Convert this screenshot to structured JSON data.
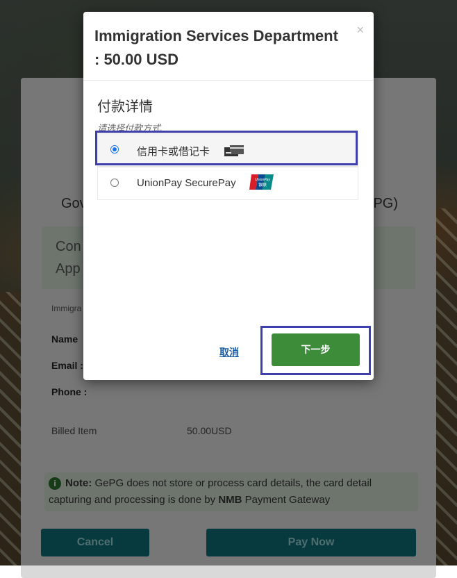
{
  "background": {
    "heading_left": "Gov",
    "heading_right": "PG)",
    "confirm_line1": "Con",
    "confirm_line2": "App",
    "immigration_label": "Immigra",
    "name_label": "Name",
    "email_label": "Email :",
    "phone_label": "Phone :",
    "billed_item_label": "Billed Item",
    "billed_item_value": "50.00USD",
    "note_prefix": "Note:",
    "note_text_1": " GePG does not store or process card details, the card detail capturing and processing is done by ",
    "note_bold": "NMB",
    "note_text_2": " Payment Gateway",
    "cancel_button": "Cancel",
    "pay_button": "Pay Now"
  },
  "modal": {
    "title": "Immigration Services Department : 50.00 USD",
    "close": "×",
    "section_title": "付款详情",
    "section_subtitle": "请选择付款方式.",
    "options": [
      {
        "label": "信用卡或借记卡",
        "selected": true,
        "icon": "credit-card-icon"
      },
      {
        "label": "UnionPay SecurePay",
        "selected": false,
        "icon": "unionpay-logo"
      }
    ],
    "cancel_link": "取消",
    "next_button": "下一步"
  },
  "colors": {
    "next_button": "#3d8c3a",
    "highlight_border": "#3f3fae",
    "primary_button": "#0e6b73"
  }
}
